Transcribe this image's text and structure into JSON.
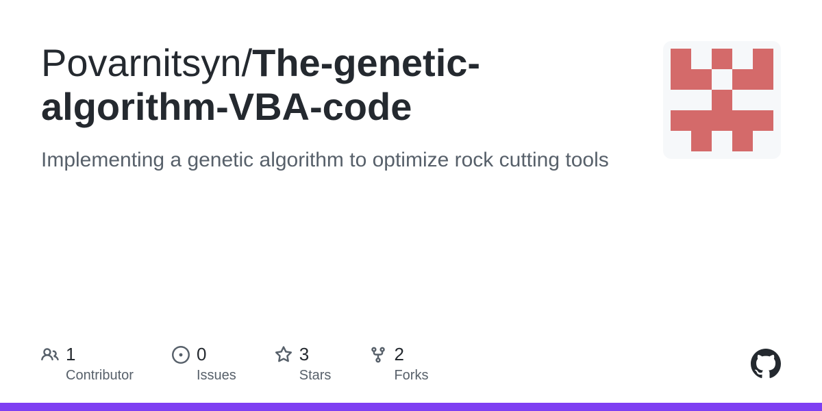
{
  "repo": {
    "owner": "Povarnitsyn",
    "name": "The-genetic-algorithm-VBA-code",
    "description": "Implementing a genetic algorithm to optimize rock cutting tools"
  },
  "stats": {
    "contributors": {
      "count": "1",
      "label": "Contributor"
    },
    "issues": {
      "count": "0",
      "label": "Issues"
    },
    "stars": {
      "count": "3",
      "label": "Stars"
    },
    "forks": {
      "count": "2",
      "label": "Forks"
    }
  },
  "colors": {
    "accent": "#7e3ff2",
    "avatar": "#d46a6a"
  }
}
